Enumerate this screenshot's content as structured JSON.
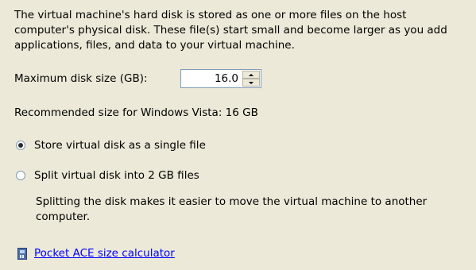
{
  "intro_text": "The virtual machine's hard disk is stored as one or more files on the host computer's physical disk. These file(s) start small and become larger as you add applications, files, and data to your virtual machine.",
  "disk_size": {
    "label": "Maximum disk size (GB):",
    "value": "16.0"
  },
  "recommended_text": "Recommended size for Windows Vista: 16 GB",
  "storage_options": [
    {
      "label": "Store virtual disk as a single file",
      "selected": true
    },
    {
      "label": "Split virtual disk into 2 GB files",
      "selected": false
    }
  ],
  "split_description": "Splitting the disk makes it easier to move the virtual machine to another computer.",
  "calculator_link": {
    "label": "Pocket ACE size calculator",
    "icon": "calculator-icon",
    "color": "#0000ff"
  }
}
